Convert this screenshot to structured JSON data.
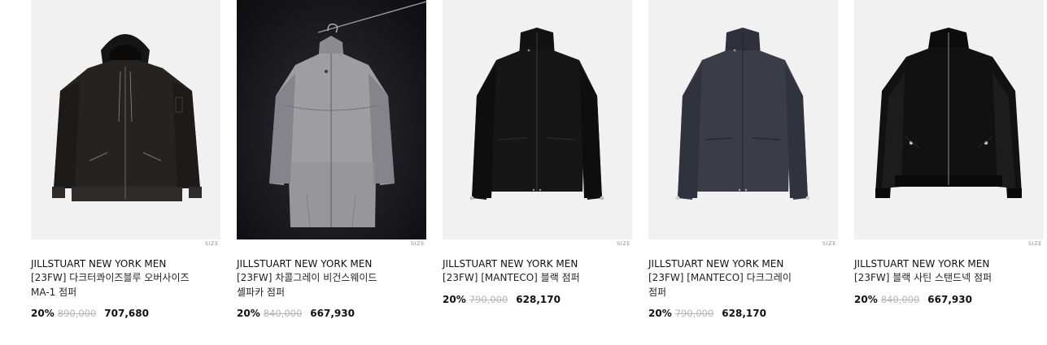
{
  "size_label": "SIZE",
  "products": [
    {
      "brand": "JILLSTUART NEW YORK MEN",
      "name": "[23FW] 다크터콰이즈블루 오버사이즈 MA-1 점퍼",
      "discount": "20%",
      "original_price": "890,000",
      "sale_price": "707,680",
      "image_icon": "hooded-ma1-jacket-image"
    },
    {
      "brand": "JILLSTUART NEW YORK MEN",
      "name": "[23FW] 차콜그레이 비건스웨이드 셸파카 점퍼",
      "discount": "20%",
      "original_price": "840,000",
      "sale_price": "667,930",
      "image_icon": "suede-jacket-on-hanger-image"
    },
    {
      "brand": "JILLSTUART NEW YORK MEN",
      "name": "[23FW] [MANTECO] 블랙 점퍼",
      "discount": "20%",
      "original_price": "790,000",
      "sale_price": "628,170",
      "image_icon": "black-stand-collar-jacket-image"
    },
    {
      "brand": "JILLSTUART NEW YORK MEN",
      "name": "[23FW] [MANTECO] 다크그레이 점퍼",
      "discount": "20%",
      "original_price": "790,000",
      "sale_price": "628,170",
      "image_icon": "darkgray-stand-collar-jacket-image"
    },
    {
      "brand": "JILLSTUART NEW YORK MEN",
      "name": "[23FW] 블랙 사틴 스탠드넥 점퍼",
      "discount": "20%",
      "original_price": "840,000",
      "sale_price": "667,930",
      "image_icon": "black-satin-bomber-image"
    }
  ],
  "colors": {
    "text": "#111111",
    "strike_price": "#b5b5b5",
    "thumb_bg": "#f1f1f1",
    "size_tag": "#8d8d8d"
  }
}
